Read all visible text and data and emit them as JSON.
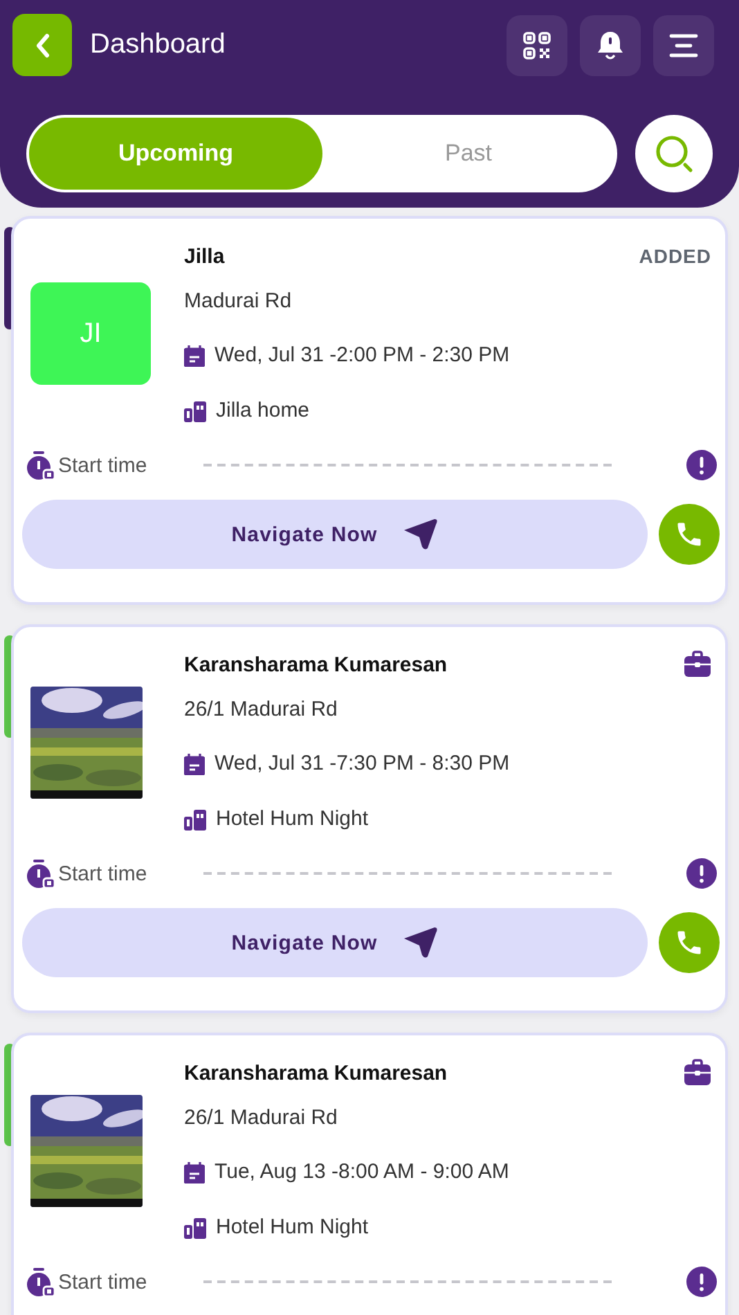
{
  "header": {
    "title": "Dashboard"
  },
  "tabs": [
    {
      "label": "Upcoming",
      "selected": true
    },
    {
      "label": "Past",
      "selected": false
    }
  ],
  "bookings": [
    {
      "color": "#3f2166",
      "avatar": {
        "kind": "initials",
        "text": "JI",
        "color": "#3ef556"
      },
      "name": "Jilla",
      "badge": {
        "kind": "text",
        "text": "ADDED"
      },
      "address": "Madurai Rd",
      "datetime": "Wed, Jul 31 -2:00 PM - 2:30 PM",
      "place": "Jilla home",
      "start_label": "Start time",
      "navigate_label": "Navigate Now"
    },
    {
      "color": "#5cc34a",
      "name": "Karansharama Kumaresan",
      "badge": {
        "kind": "briefcase"
      },
      "address": "26/1 Madurai Rd",
      "datetime": "Wed, Jul 31 -7:30 PM - 8:30 PM",
      "place": "Hotel Hum Night",
      "start_label": "Start time",
      "navigate_label": "Navigate Now"
    },
    {
      "color": "#5cc34a",
      "name": "Karansharama Kumaresan",
      "badge": {
        "kind": "briefcase"
      },
      "address": "26/1 Madurai Rd",
      "datetime": "Tue, Aug 13 -8:00 AM - 9:00 AM",
      "place": "Hotel Hum Night",
      "start_label": "Start time"
    }
  ]
}
